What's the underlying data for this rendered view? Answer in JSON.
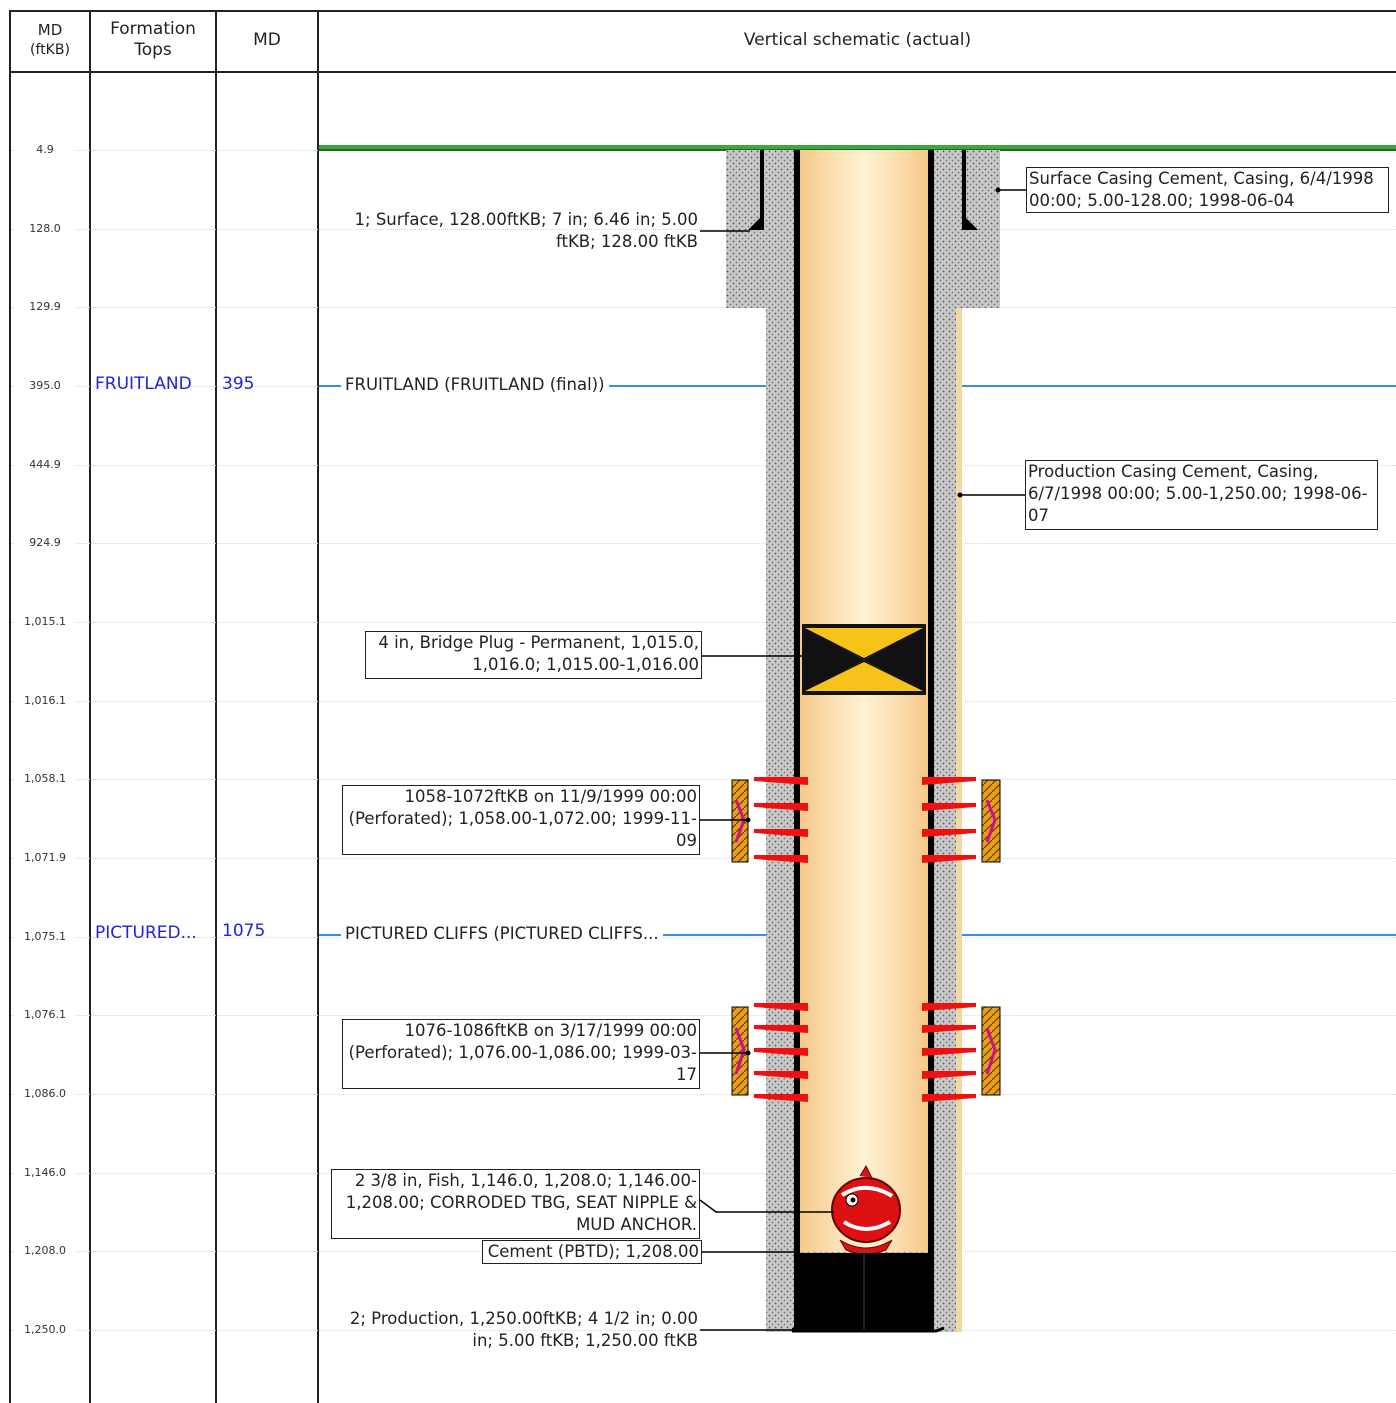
{
  "header": {
    "col_md_ftkb": [
      "MD",
      "(ftKB)"
    ],
    "col_formation_tops": [
      "Formation",
      "Tops"
    ],
    "col_md": "MD",
    "col_schematic": "Vertical schematic (actual)"
  },
  "md_ticks": [
    "4.9",
    "128.0",
    "129.9",
    "395.0",
    "444.9",
    "924.9",
    "1,015.1",
    "1,016.1",
    "1,058.1",
    "1,071.9",
    "1,075.1",
    "1,076.1",
    "1,086.0",
    "1,146.0",
    "1,208.0",
    "1,250.0"
  ],
  "formations": [
    {
      "name": "FRUITLAND",
      "md": "395",
      "line_label": "FRUITLAND (FRUITLAND (final))"
    },
    {
      "name": "PICTURED...",
      "md": "1075",
      "line_label": "PICTURED CLIFFS (PICTURED CLIFFS..."
    }
  ],
  "labels": {
    "surface_casing": [
      "1; Surface, 128.00ftKB; 7 in; 6.46 in; 5.00",
      "ftKB; 128.00 ftKB"
    ],
    "surface_cement": [
      "Surface Casing Cement, Casing, 6/4/1998",
      "00:00; 5.00-128.00; 1998-06-04"
    ],
    "production_cement": [
      "Production Casing Cement, Casing,",
      "6/7/1998 00:00; 5.00-1,250.00; 1998-06-",
      "07"
    ],
    "bridge_plug": [
      "4 in, Bridge Plug - Permanent, 1,015.0,",
      "1,016.0; 1,015.00-1,016.00"
    ],
    "perf_1": [
      "1058-1072ftKB on 11/9/1999 00:00",
      "(Perforated); 1,058.00-1,072.00; 1999-11-",
      "09"
    ],
    "perf_2": [
      "1076-1086ftKB on 3/17/1999 00:00",
      "(Perforated); 1,076.00-1,086.00; 1999-03-",
      "17"
    ],
    "fish": [
      "2 3/8 in, Fish, 1,146.0, 1,208.0; 1,146.00-",
      "1,208.00; CORRODED TBG, SEAT NIPPLE &",
      "MUD ANCHOR."
    ],
    "cement_pbtd": "Cement (PBTD); 1,208.00",
    "production_casing": [
      "2; Production, 1,250.00ftKB; 4 1/2 in; 0.00",
      "in; 5.00 ftKB; 1,250.00 ftKB"
    ]
  },
  "colors": {
    "formation_text": "#2222dd",
    "formation_line": "#3a8ee6",
    "wellbore_fill": "#fde2a8",
    "plug_yellow": "#f7c21a",
    "perf_red": "#ee1111",
    "ground_green": "#3aa83a"
  }
}
